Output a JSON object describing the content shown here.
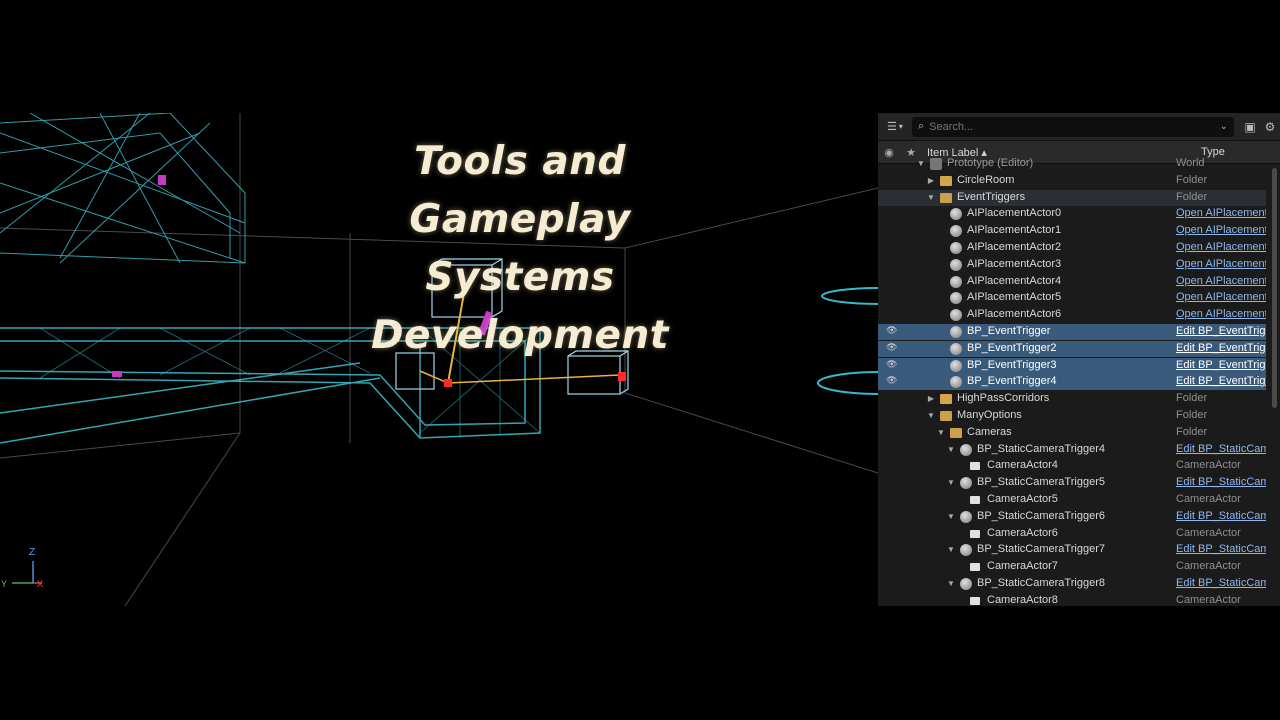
{
  "title": {
    "line1": "Tools and Gameplay",
    "line2": "Systems Development"
  },
  "viewport": {
    "axis_z": "Z",
    "axis_y": "Y",
    "axis_x": "X"
  },
  "outliner": {
    "search_placeholder": "Search...",
    "col_label": "Item Label ▴",
    "col_type": "Type",
    "rows": [
      {
        "name": "Prototype (Editor)",
        "type": "World",
        "indent": 0,
        "arrow": "down",
        "icon": "world",
        "link": false,
        "sel": false
      },
      {
        "name": "CircleRoom",
        "type": "Folder",
        "indent": 1,
        "arrow": "right",
        "icon": "folder",
        "link": false,
        "sel": false
      },
      {
        "name": "EventTriggers",
        "type": "Folder",
        "indent": 1,
        "arrow": "down",
        "icon": "folder-open",
        "link": false,
        "sel": false,
        "hl": true
      },
      {
        "name": "AIPlacementActor0",
        "type": "Open AIPlacementActor",
        "indent": 2,
        "arrow": "",
        "icon": "actor",
        "link": true,
        "sel": false
      },
      {
        "name": "AIPlacementActor1",
        "type": "Open AIPlacementActor",
        "indent": 2,
        "arrow": "",
        "icon": "actor",
        "link": true,
        "sel": false
      },
      {
        "name": "AIPlacementActor2",
        "type": "Open AIPlacementActor",
        "indent": 2,
        "arrow": "",
        "icon": "actor",
        "link": true,
        "sel": false
      },
      {
        "name": "AIPlacementActor3",
        "type": "Open AIPlacementActor",
        "indent": 2,
        "arrow": "",
        "icon": "actor",
        "link": true,
        "sel": false
      },
      {
        "name": "AIPlacementActor4",
        "type": "Open AIPlacementActor",
        "indent": 2,
        "arrow": "",
        "icon": "actor",
        "link": true,
        "sel": false
      },
      {
        "name": "AIPlacementActor5",
        "type": "Open AIPlacementActor",
        "indent": 2,
        "arrow": "",
        "icon": "actor",
        "link": true,
        "sel": false
      },
      {
        "name": "AIPlacementActor6",
        "type": "Open AIPlacementActor",
        "indent": 2,
        "arrow": "",
        "icon": "actor",
        "link": true,
        "sel": false
      },
      {
        "name": "BP_EventTrigger",
        "type": "Edit BP_EventTrigger",
        "indent": 2,
        "arrow": "",
        "icon": "actor",
        "link": true,
        "sel": true
      },
      {
        "name": "BP_EventTrigger2",
        "type": "Edit BP_EventTrigger",
        "indent": 2,
        "arrow": "",
        "icon": "actor",
        "link": true,
        "sel": true
      },
      {
        "name": "BP_EventTrigger3",
        "type": "Edit BP_EventTrigger",
        "indent": 2,
        "arrow": "",
        "icon": "actor",
        "link": true,
        "sel": true
      },
      {
        "name": "BP_EventTrigger4",
        "type": "Edit BP_EventTrigger",
        "indent": 2,
        "arrow": "",
        "icon": "actor",
        "link": true,
        "sel": true
      },
      {
        "name": "HighPassCorridors",
        "type": "Folder",
        "indent": 1,
        "arrow": "right",
        "icon": "folder",
        "link": false,
        "sel": false
      },
      {
        "name": "ManyOptions",
        "type": "Folder",
        "indent": 1,
        "arrow": "down",
        "icon": "folder-open",
        "link": false,
        "sel": false
      },
      {
        "name": "Cameras",
        "type": "Folder",
        "indent": 2,
        "arrow": "down",
        "icon": "folder-open",
        "link": false,
        "sel": false
      },
      {
        "name": "BP_StaticCameraTrigger4",
        "type": "Edit BP_StaticCameraTrigger",
        "indent": 3,
        "arrow": "down",
        "icon": "actor",
        "link": true,
        "sel": false
      },
      {
        "name": "CameraActor4",
        "type": "CameraActor",
        "indent": 4,
        "arrow": "",
        "icon": "cam",
        "link": false,
        "sel": false
      },
      {
        "name": "BP_StaticCameraTrigger5",
        "type": "Edit BP_StaticCameraTrigger",
        "indent": 3,
        "arrow": "down",
        "icon": "actor",
        "link": true,
        "sel": false
      },
      {
        "name": "CameraActor5",
        "type": "CameraActor",
        "indent": 4,
        "arrow": "",
        "icon": "cam",
        "link": false,
        "sel": false
      },
      {
        "name": "BP_StaticCameraTrigger6",
        "type": "Edit BP_StaticCameraTrigger",
        "indent": 3,
        "arrow": "down",
        "icon": "actor",
        "link": true,
        "sel": false
      },
      {
        "name": "CameraActor6",
        "type": "CameraActor",
        "indent": 4,
        "arrow": "",
        "icon": "cam",
        "link": false,
        "sel": false
      },
      {
        "name": "BP_StaticCameraTrigger7",
        "type": "Edit BP_StaticCameraTrigger",
        "indent": 3,
        "arrow": "down",
        "icon": "actor",
        "link": true,
        "sel": false
      },
      {
        "name": "CameraActor7",
        "type": "CameraActor",
        "indent": 4,
        "arrow": "",
        "icon": "cam",
        "link": false,
        "sel": false
      },
      {
        "name": "BP_StaticCameraTrigger8",
        "type": "Edit BP_StaticCameraTrigger",
        "indent": 3,
        "arrow": "down",
        "icon": "actor",
        "link": true,
        "sel": false
      },
      {
        "name": "CameraActor8",
        "type": "CameraActor",
        "indent": 4,
        "arrow": "",
        "icon": "cam",
        "link": false,
        "sel": false
      }
    ]
  },
  "colors": {
    "wire": "#38b9c9",
    "select_row": "#3a5a7c",
    "link": "#8fb7ee",
    "folder": "#d3a64a"
  }
}
